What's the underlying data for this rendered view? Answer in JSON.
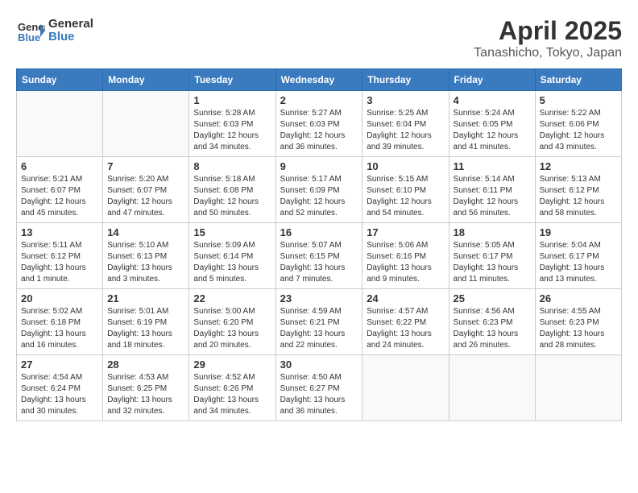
{
  "header": {
    "logo_line1": "General",
    "logo_line2": "Blue",
    "month": "April 2025",
    "location": "Tanashicho, Tokyo, Japan"
  },
  "weekdays": [
    "Sunday",
    "Monday",
    "Tuesday",
    "Wednesday",
    "Thursday",
    "Friday",
    "Saturday"
  ],
  "weeks": [
    [
      {
        "day": "",
        "detail": ""
      },
      {
        "day": "",
        "detail": ""
      },
      {
        "day": "1",
        "detail": "Sunrise: 5:28 AM\nSunset: 6:03 PM\nDaylight: 12 hours\nand 34 minutes."
      },
      {
        "day": "2",
        "detail": "Sunrise: 5:27 AM\nSunset: 6:03 PM\nDaylight: 12 hours\nand 36 minutes."
      },
      {
        "day": "3",
        "detail": "Sunrise: 5:25 AM\nSunset: 6:04 PM\nDaylight: 12 hours\nand 39 minutes."
      },
      {
        "day": "4",
        "detail": "Sunrise: 5:24 AM\nSunset: 6:05 PM\nDaylight: 12 hours\nand 41 minutes."
      },
      {
        "day": "5",
        "detail": "Sunrise: 5:22 AM\nSunset: 6:06 PM\nDaylight: 12 hours\nand 43 minutes."
      }
    ],
    [
      {
        "day": "6",
        "detail": "Sunrise: 5:21 AM\nSunset: 6:07 PM\nDaylight: 12 hours\nand 45 minutes."
      },
      {
        "day": "7",
        "detail": "Sunrise: 5:20 AM\nSunset: 6:07 PM\nDaylight: 12 hours\nand 47 minutes."
      },
      {
        "day": "8",
        "detail": "Sunrise: 5:18 AM\nSunset: 6:08 PM\nDaylight: 12 hours\nand 50 minutes."
      },
      {
        "day": "9",
        "detail": "Sunrise: 5:17 AM\nSunset: 6:09 PM\nDaylight: 12 hours\nand 52 minutes."
      },
      {
        "day": "10",
        "detail": "Sunrise: 5:15 AM\nSunset: 6:10 PM\nDaylight: 12 hours\nand 54 minutes."
      },
      {
        "day": "11",
        "detail": "Sunrise: 5:14 AM\nSunset: 6:11 PM\nDaylight: 12 hours\nand 56 minutes."
      },
      {
        "day": "12",
        "detail": "Sunrise: 5:13 AM\nSunset: 6:12 PM\nDaylight: 12 hours\nand 58 minutes."
      }
    ],
    [
      {
        "day": "13",
        "detail": "Sunrise: 5:11 AM\nSunset: 6:12 PM\nDaylight: 13 hours\nand 1 minute."
      },
      {
        "day": "14",
        "detail": "Sunrise: 5:10 AM\nSunset: 6:13 PM\nDaylight: 13 hours\nand 3 minutes."
      },
      {
        "day": "15",
        "detail": "Sunrise: 5:09 AM\nSunset: 6:14 PM\nDaylight: 13 hours\nand 5 minutes."
      },
      {
        "day": "16",
        "detail": "Sunrise: 5:07 AM\nSunset: 6:15 PM\nDaylight: 13 hours\nand 7 minutes."
      },
      {
        "day": "17",
        "detail": "Sunrise: 5:06 AM\nSunset: 6:16 PM\nDaylight: 13 hours\nand 9 minutes."
      },
      {
        "day": "18",
        "detail": "Sunrise: 5:05 AM\nSunset: 6:17 PM\nDaylight: 13 hours\nand 11 minutes."
      },
      {
        "day": "19",
        "detail": "Sunrise: 5:04 AM\nSunset: 6:17 PM\nDaylight: 13 hours\nand 13 minutes."
      }
    ],
    [
      {
        "day": "20",
        "detail": "Sunrise: 5:02 AM\nSunset: 6:18 PM\nDaylight: 13 hours\nand 16 minutes."
      },
      {
        "day": "21",
        "detail": "Sunrise: 5:01 AM\nSunset: 6:19 PM\nDaylight: 13 hours\nand 18 minutes."
      },
      {
        "day": "22",
        "detail": "Sunrise: 5:00 AM\nSunset: 6:20 PM\nDaylight: 13 hours\nand 20 minutes."
      },
      {
        "day": "23",
        "detail": "Sunrise: 4:59 AM\nSunset: 6:21 PM\nDaylight: 13 hours\nand 22 minutes."
      },
      {
        "day": "24",
        "detail": "Sunrise: 4:57 AM\nSunset: 6:22 PM\nDaylight: 13 hours\nand 24 minutes."
      },
      {
        "day": "25",
        "detail": "Sunrise: 4:56 AM\nSunset: 6:23 PM\nDaylight: 13 hours\nand 26 minutes."
      },
      {
        "day": "26",
        "detail": "Sunrise: 4:55 AM\nSunset: 6:23 PM\nDaylight: 13 hours\nand 28 minutes."
      }
    ],
    [
      {
        "day": "27",
        "detail": "Sunrise: 4:54 AM\nSunset: 6:24 PM\nDaylight: 13 hours\nand 30 minutes."
      },
      {
        "day": "28",
        "detail": "Sunrise: 4:53 AM\nSunset: 6:25 PM\nDaylight: 13 hours\nand 32 minutes."
      },
      {
        "day": "29",
        "detail": "Sunrise: 4:52 AM\nSunset: 6:26 PM\nDaylight: 13 hours\nand 34 minutes."
      },
      {
        "day": "30",
        "detail": "Sunrise: 4:50 AM\nSunset: 6:27 PM\nDaylight: 13 hours\nand 36 minutes."
      },
      {
        "day": "",
        "detail": ""
      },
      {
        "day": "",
        "detail": ""
      },
      {
        "day": "",
        "detail": ""
      }
    ]
  ]
}
